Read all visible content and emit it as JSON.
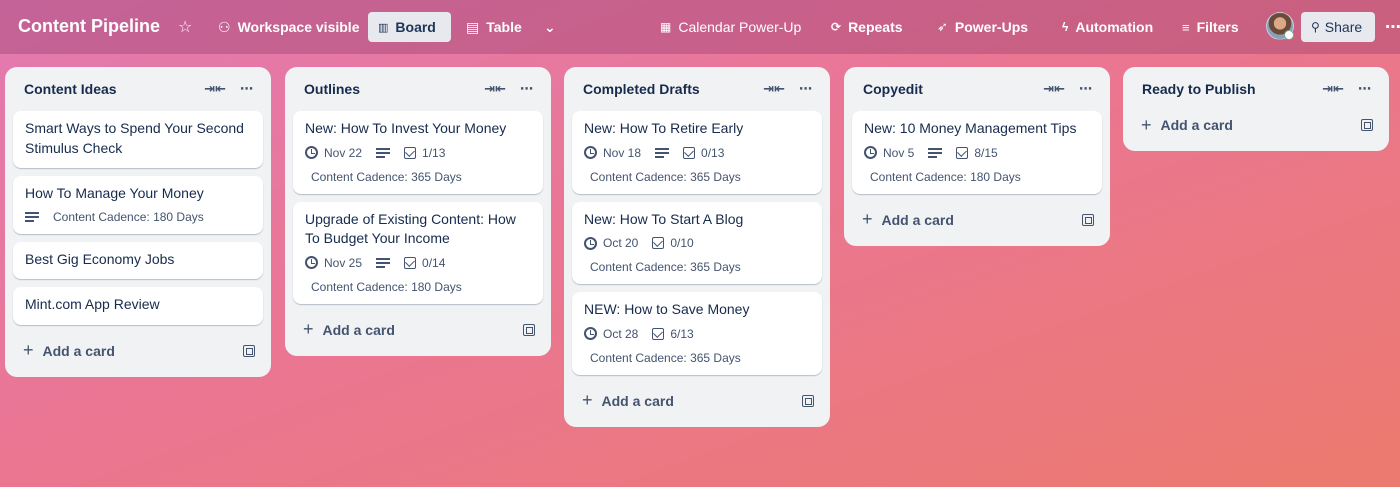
{
  "header": {
    "title": "Content Pipeline",
    "visibility": "Workspace visible",
    "views": {
      "board": "Board",
      "table": "Table"
    },
    "calendar": "Calendar Power-Up",
    "repeats": "Repeats",
    "powerups": "Power-Ups",
    "automation": "Automation",
    "filters": "Filters",
    "share": "Share"
  },
  "lists": [
    {
      "title": "Content Ideas",
      "cards": [
        {
          "title": "Smart Ways to Spend Your Second Stimulus Check"
        },
        {
          "title": "How To Manage Your Money",
          "cadence": "Content Cadence: 180 Days"
        },
        {
          "title": "Best Gig Economy Jobs"
        },
        {
          "title": "Mint.com App Review"
        }
      ],
      "add_label": "Add a card"
    },
    {
      "title": "Outlines",
      "cards": [
        {
          "title": "New: How To Invest Your Money",
          "date": "Nov 22",
          "checklist": "1/13",
          "cadence": "Content Cadence: 365 Days"
        },
        {
          "title": "Upgrade of Existing Content: How To Budget Your Income",
          "date": "Nov 25",
          "checklist": "0/14",
          "cadence": "Content Cadence: 180 Days"
        }
      ],
      "add_label": "Add a card"
    },
    {
      "title": "Completed Drafts",
      "cards": [
        {
          "title": "New: How To Retire Early",
          "date": "Nov 18",
          "checklist": "0/13",
          "cadence": "Content Cadence: 365 Days"
        },
        {
          "title": "New: How To Start A Blog",
          "date": "Oct 20",
          "checklist": "0/10",
          "cadence": "Content Cadence: 365 Days"
        },
        {
          "title": "NEW: How to Save Money",
          "date": "Oct 28",
          "checklist": "6/13",
          "cadence": "Content Cadence: 365 Days"
        }
      ],
      "add_label": "Add a card"
    },
    {
      "title": "Copyedit",
      "cards": [
        {
          "title": "New: 10 Money Management Tips",
          "date": "Nov 5",
          "checklist": "8/15",
          "cadence": "Content Cadence: 180 Days"
        }
      ],
      "add_label": "Add a card"
    },
    {
      "title": "Ready to Publish",
      "cards": [],
      "add_label": "Add a card"
    }
  ]
}
